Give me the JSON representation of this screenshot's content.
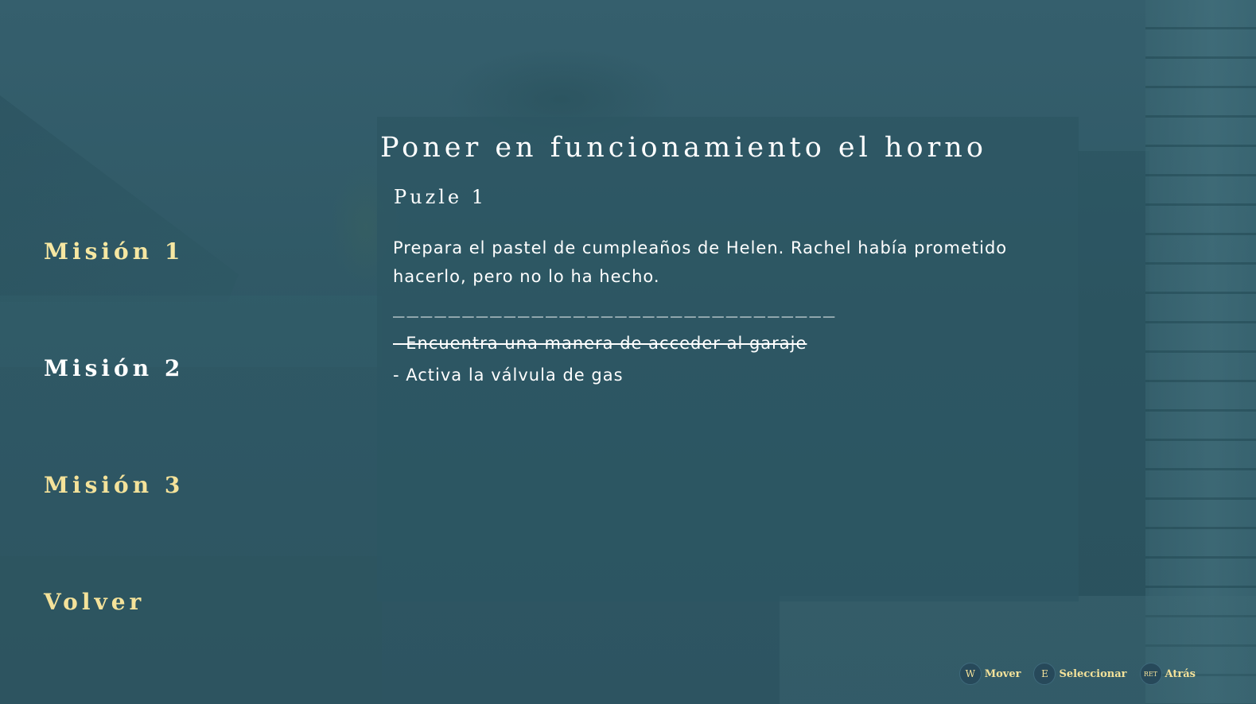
{
  "menu": {
    "items": [
      {
        "label": "Misión 1",
        "state": "active"
      },
      {
        "label": "Misión 2",
        "state": "inactive"
      },
      {
        "label": "Misión 3",
        "state": "dim"
      },
      {
        "label": "Volver",
        "state": "dim"
      }
    ]
  },
  "mission": {
    "title": "Poner en funcionamiento el horno",
    "subtitle": "Puzle 1",
    "description": "Prepara el pastel de cumpleaños de Helen. Rachel había prometido hacerlo, pero no lo ha hecho.",
    "separator": "________________________________",
    "tasks": [
      {
        "text": "- Encuentra una manera de acceder al garaje",
        "completed": true
      },
      {
        "text": "- Activa la válvula de gas",
        "completed": false
      }
    ]
  },
  "hints": [
    {
      "key": "W",
      "label": "Mover"
    },
    {
      "key": "E",
      "label": "Seleccionar"
    },
    {
      "key": "RET",
      "label": "Atrás"
    }
  ],
  "colors": {
    "accent": "#f6e7a2",
    "background": "#2f5664",
    "text": "#ffffff"
  }
}
